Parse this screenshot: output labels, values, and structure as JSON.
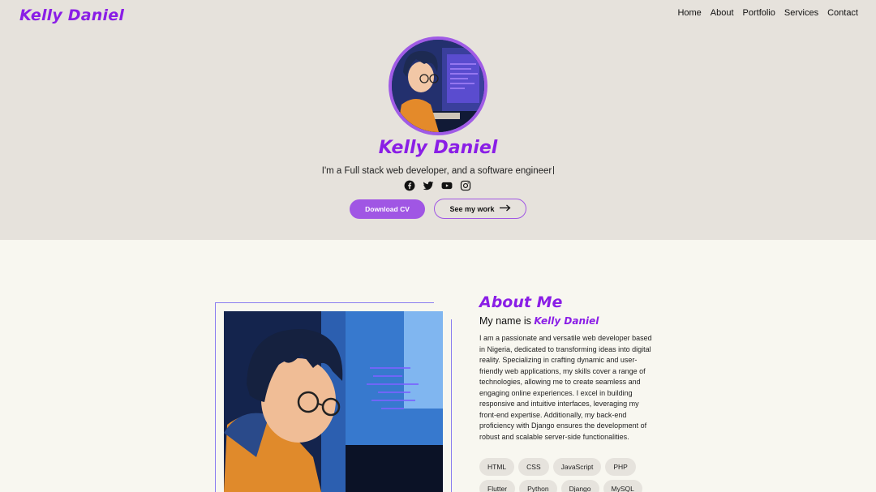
{
  "header": {
    "brand": "Kelly Daniel",
    "nav": [
      "Home",
      "About",
      "Portfolio",
      "Services",
      "Contact"
    ]
  },
  "hero": {
    "name": "Kelly Daniel",
    "tagline": "I'm a Full stack web developer, and a software engineer",
    "socials": [
      "facebook-icon",
      "twitter-icon",
      "youtube-icon",
      "instagram-icon"
    ],
    "download_label": "Download CV",
    "work_label": "See my work"
  },
  "about": {
    "title": "About Me",
    "intro": "My name is ",
    "name": "Kelly Daniel",
    "text": "I am a passionate and versatile web developer based in Nigeria, dedicated to transforming ideas into digital reality. Specializing in crafting dynamic and user-friendly web applications, my skills cover a range of technologies, allowing me to create seamless and engaging online experiences. I excel in building responsive and intuitive interfaces, leveraging my front-end expertise. Additionally, my back-end proficiency with Django ensures the development of robust and scalable server-side functionalities.",
    "skills": [
      "HTML",
      "CSS",
      "JavaScript",
      "PHP",
      "Flutter",
      "Python",
      "Django",
      "MySQL"
    ]
  },
  "colors": {
    "accent": "#8a1ee6",
    "button": "#a056e4",
    "hero_bg": "#e6e2dc",
    "page_bg": "#f8f7f0"
  }
}
